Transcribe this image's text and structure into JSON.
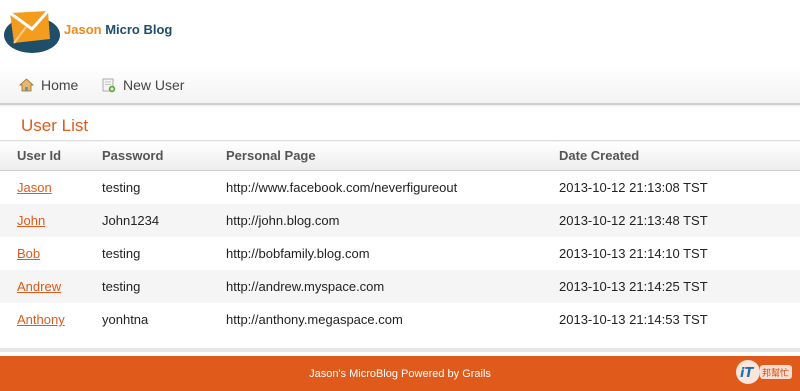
{
  "header": {
    "brand_part1": "Jason",
    "brand_part2": " Micro Blog",
    "logo_icon": "envelope-icon"
  },
  "nav": {
    "items": [
      {
        "label": "Home",
        "icon": "home-icon"
      },
      {
        "label": "New User",
        "icon": "new-user-icon"
      }
    ]
  },
  "main": {
    "title": "User List",
    "columns": [
      "User Id",
      "Password",
      "Personal Page",
      "Date Created"
    ],
    "rows": [
      {
        "user_id": "Jason",
        "password": "testing",
        "page": "http://www.facebook.com/neverfigureout",
        "date": "2013-10-12 21:13:08 TST"
      },
      {
        "user_id": "John",
        "password": "John1234",
        "page": "http://john.blog.com",
        "date": "2013-10-12 21:13:48 TST"
      },
      {
        "user_id": "Bob",
        "password": "testing",
        "page": "http://bobfamily.blog.com",
        "date": "2013-10-13 21:14:10 TST"
      },
      {
        "user_id": "Andrew",
        "password": "testing",
        "page": "http://andrew.myspace.com",
        "date": "2013-10-13 21:14:25 TST"
      },
      {
        "user_id": "Anthony",
        "password": "yonhtna",
        "page": "http://anthony.megaspace.com",
        "date": "2013-10-13 21:14:53 TST"
      }
    ]
  },
  "footer": {
    "text": "Jason's MicroBlog Powered by Grails"
  },
  "watermark": {
    "label_it": "iT",
    "label_cn": "邦幫忙"
  },
  "colors": {
    "accent": "#e05a1c",
    "brand_orange": "#f08a1c",
    "brand_navy": "#1e4e68"
  }
}
